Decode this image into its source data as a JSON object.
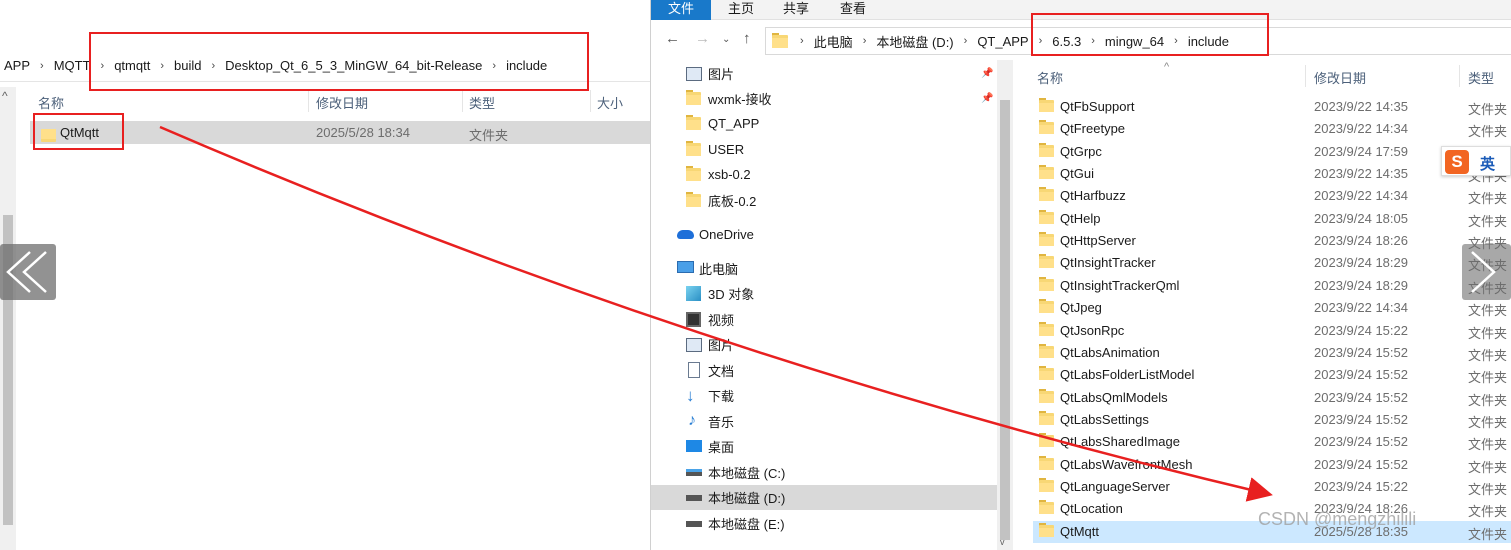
{
  "left_window": {
    "breadcrumbs": [
      "APP",
      "MQTT",
      "qtmqtt",
      "build",
      "Desktop_Qt_6_5_3_MinGW_64_bit-Release",
      "include"
    ],
    "columns": {
      "name": "名称",
      "date": "修改日期",
      "type": "类型",
      "size": "大小"
    },
    "rows": [
      {
        "name": "QtMqtt",
        "date": "2025/5/28 18:34",
        "type": "文件夹"
      }
    ]
  },
  "right_window": {
    "ribbon_tabs": [
      "文件",
      "主页",
      "共享",
      "查看"
    ],
    "breadcrumbs": [
      "此电脑",
      "本地磁盘 (D:)",
      "QT_APP",
      "6.5.3",
      "mingw_64",
      "include"
    ],
    "sidebar_items": [
      {
        "label": "图片",
        "icon": "pictures-icon",
        "pinned": true
      },
      {
        "label": "wxmk-接收",
        "icon": "folder-icon",
        "pinned": true
      },
      {
        "label": "QT_APP",
        "icon": "folder-icon"
      },
      {
        "label": "USER",
        "icon": "folder-icon"
      },
      {
        "label": "xsb-0.2",
        "icon": "folder-icon"
      },
      {
        "label": "底板-0.2",
        "icon": "folder-icon"
      },
      {
        "label": "OneDrive",
        "icon": "onedrive-icon"
      },
      {
        "label": "此电脑",
        "icon": "this-pc-icon"
      },
      {
        "label": "3D 对象",
        "icon": "3d-objects-icon"
      },
      {
        "label": "视频",
        "icon": "videos-icon"
      },
      {
        "label": "图片",
        "icon": "pictures-icon"
      },
      {
        "label": "文档",
        "icon": "documents-icon"
      },
      {
        "label": "下载",
        "icon": "downloads-icon"
      },
      {
        "label": "音乐",
        "icon": "music-icon"
      },
      {
        "label": "桌面",
        "icon": "desktop-icon"
      },
      {
        "label": "本地磁盘 (C:)",
        "icon": "drive-c-icon"
      },
      {
        "label": "本地磁盘 (D:)",
        "icon": "drive-icon",
        "selected": true
      },
      {
        "label": "本地磁盘 (E:)",
        "icon": "drive-icon"
      }
    ],
    "columns": {
      "name": "名称",
      "date": "修改日期",
      "type": "类型"
    },
    "rows": [
      {
        "name": "QtFbSupport",
        "date": "2023/9/22 14:35",
        "type": "文件夹"
      },
      {
        "name": "QtFreetype",
        "date": "2023/9/22 14:34",
        "type": "文件夹"
      },
      {
        "name": "QtGrpc",
        "date": "2023/9/24 17:59",
        "type": "文件夹"
      },
      {
        "name": "QtGui",
        "date": "2023/9/22 14:35",
        "type": "文件夹"
      },
      {
        "name": "QtHarfbuzz",
        "date": "2023/9/22 14:34",
        "type": "文件夹"
      },
      {
        "name": "QtHelp",
        "date": "2023/9/24 18:05",
        "type": "文件夹"
      },
      {
        "name": "QtHttpServer",
        "date": "2023/9/24 18:26",
        "type": "文件夹"
      },
      {
        "name": "QtInsightTracker",
        "date": "2023/9/24 18:29",
        "type": "文件夹"
      },
      {
        "name": "QtInsightTrackerQml",
        "date": "2023/9/24 18:29",
        "type": "文件夹"
      },
      {
        "name": "QtJpeg",
        "date": "2023/9/22 14:34",
        "type": "文件夹"
      },
      {
        "name": "QtJsonRpc",
        "date": "2023/9/24 15:22",
        "type": "文件夹"
      },
      {
        "name": "QtLabsAnimation",
        "date": "2023/9/24 15:52",
        "type": "文件夹"
      },
      {
        "name": "QtLabsFolderListModel",
        "date": "2023/9/24 15:52",
        "type": "文件夹"
      },
      {
        "name": "QtLabsQmlModels",
        "date": "2023/9/24 15:52",
        "type": "文件夹"
      },
      {
        "name": "QtLabsSettings",
        "date": "2023/9/24 15:52",
        "type": "文件夹"
      },
      {
        "name": "QtLabsSharedImage",
        "date": "2023/9/24 15:52",
        "type": "文件夹"
      },
      {
        "name": "QtLabsWavefrontMesh",
        "date": "2023/9/24 15:52",
        "type": "文件夹"
      },
      {
        "name": "QtLanguageServer",
        "date": "2023/9/24 15:22",
        "type": "文件夹"
      },
      {
        "name": "QtLocation",
        "date": "2023/9/24 18:26",
        "type": "文件夹"
      },
      {
        "name": "QtMqtt",
        "date": "2025/5/28 18:35",
        "type": "文件夹",
        "selected": true
      }
    ]
  },
  "overlay": {
    "ime_logo": "S",
    "ime_mode": "英",
    "watermark": "CSDN @mengzhilili",
    "accent_color": "#e82020"
  }
}
